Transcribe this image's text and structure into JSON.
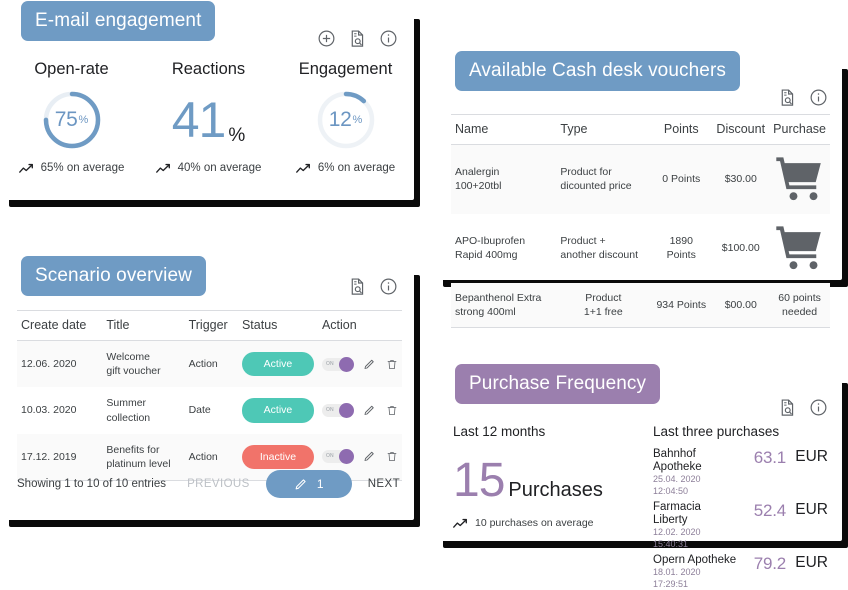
{
  "colors": {
    "badge_blue": "#6f9bc4",
    "badge_purple": "#9b7fae",
    "active_teal": "#4ec8b6",
    "inactive_red": "#f1736a",
    "toggle_knob_purple": "#8e6bb0",
    "accent_text_blue": "#6c96c2",
    "accent_text_purple": "#9b7fae"
  },
  "email_panel": {
    "title": "E-mail engagement",
    "icons": [
      "plus-circle-icon",
      "document-search-icon",
      "info-circle-icon"
    ],
    "metrics": [
      {
        "title": "Open-rate",
        "display": "donut",
        "value": 75,
        "value_text": "75",
        "unit": "%",
        "average_text": "65% on average"
      },
      {
        "title": "Reactions",
        "display": "number",
        "value": 41,
        "value_text": "41",
        "unit": "%",
        "average_text": "40% on average"
      },
      {
        "title": "Engagement",
        "display": "donut",
        "value": 12,
        "value_text": "12",
        "unit": "%",
        "average_text": "6% on average"
      }
    ]
  },
  "vouchers_panel": {
    "title": "Available Cash desk vouchers",
    "icons": [
      "document-search-icon",
      "info-circle-icon"
    ],
    "columns": [
      "Name",
      "Type",
      "Points",
      "Discount",
      "Purchase"
    ],
    "rows": [
      {
        "name": "Analergin\n100+20tbl",
        "name_line1": "Analergin",
        "name_line2": "100+20tbl",
        "type_line1": "Product for",
        "type_line2": "dicounted price",
        "points": "0 Points",
        "discount": "$30.00",
        "purchase_icon": "shopping-cart-icon",
        "purchase_text": ""
      },
      {
        "name_line1": "APO-Ibuprofen",
        "name_line2": "Rapid 400mg",
        "type_line1": "Product +",
        "type_line2": "another discount",
        "points": "1890 Points",
        "discount": "$100.00",
        "purchase_icon": "shopping-cart-icon",
        "purchase_text": ""
      },
      {
        "name_line1": "Bepanthenol Extra",
        "name_line2": "strong 400ml",
        "type_line1": "Product",
        "type_line2": "1+1 free",
        "points": "934 Points",
        "discount": "$00.00",
        "purchase_icon": "",
        "purchase_text_line1": "60 points",
        "purchase_text_line2": "needed"
      }
    ]
  },
  "scenario_panel": {
    "title": "Scenario overview",
    "icons": [
      "document-search-icon",
      "info-circle-icon"
    ],
    "columns": [
      "Create date",
      "Title",
      "Trigger",
      "Status",
      "Action"
    ],
    "rows": [
      {
        "create_date": "12.06. 2020",
        "title_line1": "Welcome",
        "title_line2": "gift voucher",
        "trigger": "Action",
        "status": "Active",
        "status_kind": "active",
        "toggle_label": "ON",
        "toggle_on": true
      },
      {
        "create_date": "10.03. 2020",
        "title_line1": "Summer",
        "title_line2": "collection",
        "trigger": "Date",
        "status": "Active",
        "status_kind": "active",
        "toggle_label": "ON",
        "toggle_on": true
      },
      {
        "create_date": "17.12. 2019",
        "title_line1": "Benefits for",
        "title_line2": "platinum level",
        "trigger": "Action",
        "status": "Inactive",
        "status_kind": "inactive",
        "toggle_label": "ON",
        "toggle_on": true
      }
    ],
    "footer": {
      "entries_text": "Showing 1 to 10 of 10 entries",
      "previous_label": "PREVIOUS",
      "current_page": "1",
      "next_label": "NEXT"
    }
  },
  "purchase_panel": {
    "title": "Purchase Frequency",
    "icons": [
      "document-search-icon",
      "info-circle-icon"
    ],
    "left_heading": "Last 12 months",
    "count": "15",
    "count_word": "Purchases",
    "average_text": "10 purchases on average",
    "right_heading": "Last three purchases",
    "purchases": [
      {
        "shop": "Bahnhof Apotheke",
        "date": "25.04. 2020 12:04:50",
        "amount": "63.1",
        "currency": "EUR"
      },
      {
        "shop": "Farmacia Liberty",
        "date": "12.02. 2020 15:40:31",
        "amount": "52.4",
        "currency": "EUR"
      },
      {
        "shop": "Opern Apotheke",
        "date": "18.01. 2020 17:29:51",
        "amount": "79.2",
        "currency": "EUR"
      }
    ]
  }
}
